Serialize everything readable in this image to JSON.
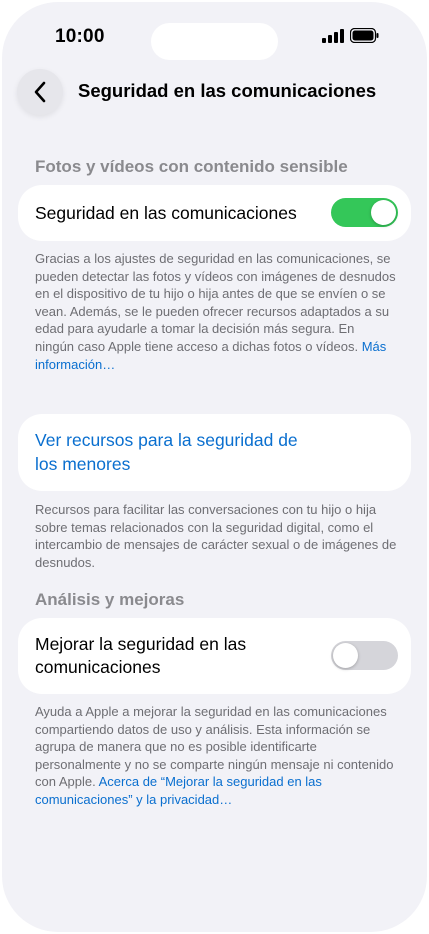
{
  "status_bar": {
    "time": "10:00"
  },
  "nav": {
    "title": "Seguridad en las comunicaciones"
  },
  "sections": {
    "photos": {
      "header": "Fotos y vídeos con contenido sensible",
      "toggle_label": "Seguridad en las comunicaciones",
      "toggle_on": true,
      "footnote": "Gracias a los ajustes de seguridad en las comunicaciones, se pueden detectar las fotos y vídeos con imágenes de desnudos en el dispositivo de tu hijo o hija antes de que se envíen o se vean. Además, se le pueden ofrecer recursos adaptados a su edad para ayudarle a tomar la decisión más segura. En ningún caso Apple tiene acceso a dichas fotos o vídeos.",
      "footnote_link": "Más información…"
    },
    "resources": {
      "link_line1": "Ver recursos para la seguridad de",
      "link_line2": "los menores",
      "footnote": "Recursos para facilitar las conversaciones con tu hijo o hija sobre temas relacionados con la seguridad digital, como el intercambio de mensajes de carácter sexual o de imágenes de desnudos."
    },
    "analytics": {
      "header": "Análisis y mejoras",
      "toggle_label_line1": "Mejorar la seguridad en las",
      "toggle_label_line2": "comunicaciones",
      "toggle_on": false,
      "footnote": "Ayuda a Apple a mejorar la seguridad en las comunicaciones compartiendo datos de uso y análisis. Esta información se agrupa de manera que no es posible identificarte personalmente y no se comparte ningún mensaje ni contenido con Apple.",
      "footnote_link": "Acerca de “Mejorar la seguridad en las comunicaciones” y la privacidad…"
    }
  },
  "colors": {
    "accent": "#0a6fcf",
    "toggle_on": "#34c759",
    "toggle_off": "#d5d5da",
    "background": "#f2f2f7"
  },
  "icons": {
    "back": "chevron-left-icon",
    "signal": "cellular-signal-icon",
    "battery": "battery-icon"
  }
}
